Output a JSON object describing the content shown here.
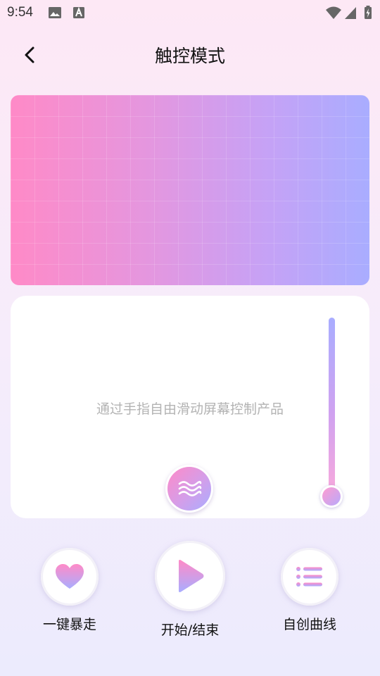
{
  "status_bar": {
    "time": "9:54",
    "icons": [
      "image-icon",
      "text-a-icon",
      "wifi-icon",
      "signal-icon",
      "battery-charging-icon"
    ]
  },
  "header": {
    "back_icon": "chevron-left-icon",
    "title": "触控模式"
  },
  "control_panel": {
    "hint": "通过手指自由滑动屏幕控制产品",
    "knob_icon": "wave-icon",
    "intensity_level": 0
  },
  "actions": {
    "rush": {
      "icon": "heart-icon",
      "label": "一键暴走"
    },
    "play": {
      "icon": "play-icon",
      "label": "开始/结束"
    },
    "curve": {
      "icon": "list-icon",
      "label": "自创曲线"
    }
  },
  "colors": {
    "pink": "#ff8ac7",
    "violet": "#a9adff",
    "hint_text": "#b3b3b3"
  }
}
